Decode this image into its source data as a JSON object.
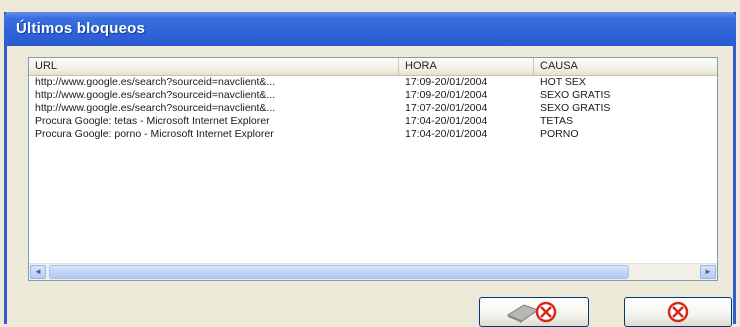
{
  "window": {
    "title": "Últimos bloqueos"
  },
  "table": {
    "columns": [
      "URL",
      "HORA",
      "CAUSA"
    ],
    "rows": [
      {
        "url": "http://www.google.es/search?sourceid=navclient&...",
        "hora": "17:09-20/01/2004",
        "causa": "HOT SEX"
      },
      {
        "url": "http://www.google.es/search?sourceid=navclient&...",
        "hora": "17:09-20/01/2004",
        "causa": "SEXO GRATIS"
      },
      {
        "url": "http://www.google.es/search?sourceid=navclient&...",
        "hora": "17:07-20/01/2004",
        "causa": "SEXO GRATIS"
      },
      {
        "url": "Procura Google: tetas - Microsoft Internet Explorer",
        "hora": "17:04-20/01/2004",
        "causa": "TETAS"
      },
      {
        "url": "Procura Google: porno - Microsoft Internet Explorer",
        "hora": "17:04-20/01/2004",
        "causa": "PORNO"
      }
    ]
  },
  "scrollbar": {
    "left_arrow": "◄",
    "right_arrow": "►"
  },
  "buttons": {
    "delete_icon": "eraser-with-cancel-icon",
    "close_icon": "cancel-circle-icon"
  },
  "colors": {
    "titlebar": "#2e62d8",
    "cancel_red": "#d62a1e"
  }
}
